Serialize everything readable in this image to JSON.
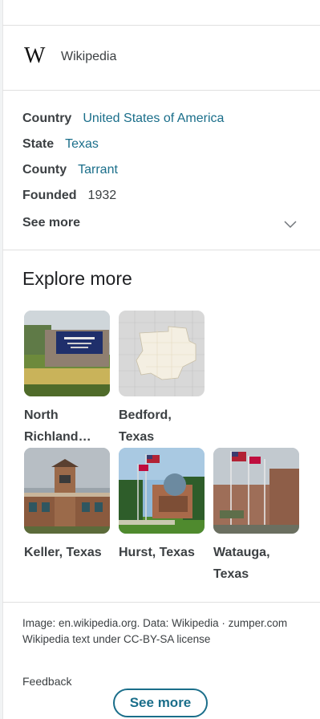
{
  "source": {
    "logo_glyph": "W",
    "label": "Wikipedia"
  },
  "facts": [
    {
      "key": "Country",
      "value": "United States of America"
    },
    {
      "key": "State",
      "value": "Texas"
    },
    {
      "key": "County",
      "value": "Tarrant"
    },
    {
      "key": "Founded",
      "value": "1932"
    }
  ],
  "facts_see_more": "See more",
  "explore": {
    "title": "Explore more",
    "tiles": [
      {
        "label": "North Richland…",
        "image": "city-sign-photo"
      },
      {
        "label": "Bedford, Texas",
        "image": "map-thumbnail"
      },
      {
        "label": "Keller, Texas",
        "image": "tower-building-photo"
      },
      {
        "label": "Hurst, Texas",
        "image": "flags-building-photo"
      },
      {
        "label": "Watauga, Texas",
        "image": "flagpoles-photo"
      }
    ]
  },
  "footer": {
    "attribution": "Image: en.wikipedia.org. Data: Wikipedia · zumper.com",
    "license": "Wikipedia text under CC-BY-SA license",
    "feedback": "Feedback"
  },
  "see_more_button": "See more",
  "colors": {
    "link": "#1a6e8a",
    "text": "#3c4043",
    "divider": "#e0e0e0"
  }
}
